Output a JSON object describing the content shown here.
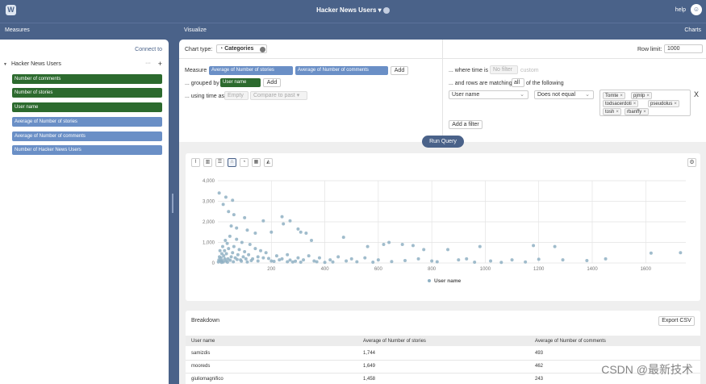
{
  "header": {
    "title": "Hacker News Users ▾",
    "help": "help"
  },
  "subbar": {
    "left": "Measures",
    "center": "Visualize",
    "right": "Charts"
  },
  "sidebar": {
    "connect": "Connect to",
    "root": "Hacker News Users",
    "dots": "···",
    "plus": "+",
    "dimensions": [
      "Number of comments",
      "Number of stories",
      "User name"
    ],
    "measures": [
      "Average of Number of stories",
      "Average of Number of comments",
      "Number of Hacker News Users"
    ]
  },
  "query": {
    "chart_type_label": "Chart type:",
    "chart_type_value": "Categories",
    "row_limit_label": "Row limit:",
    "row_limit_value": "1000",
    "measure_label": "Measure",
    "measures": [
      "Average of Number of stories",
      "Average of Number of comments"
    ],
    "add": "Add",
    "grouped_label": "... grouped by",
    "grouped_value": "User name",
    "time_label": "... using time as",
    "time_value": "Empty",
    "compare_value": "Compare to past ▾",
    "where_label": "... where time is",
    "where_value": "No filter",
    "where_custom": "custom",
    "matching_prefix": "... and rows are matching",
    "matching_value": "all",
    "matching_suffix": "of the following",
    "filter_field": "User name",
    "filter_op": "Does not equal",
    "filter_values": [
      "Tomte",
      "pjmlp",
      "todsacerdoti",
      "pseudolus",
      "tosh",
      "rbanffy"
    ],
    "clear": "X",
    "add_filter": "Add a filter",
    "run": "Run Query"
  },
  "chart_icons": [
    "line-chart-icon",
    "bar-chart-icon",
    "horizontal-bar-icon",
    "scatter-chart-icon",
    "pie-chart-icon",
    "table-icon",
    "area-chart-icon"
  ],
  "chart_data": {
    "type": "scatter",
    "title": "",
    "xlabel": "",
    "ylabel": "",
    "xlim": [
      0,
      1750
    ],
    "ylim": [
      0,
      4000
    ],
    "x_ticks": [
      "200",
      "400",
      "600",
      "800",
      "1000",
      "1200",
      "1400",
      "1600"
    ],
    "y_ticks": [
      "0",
      "1,000",
      "2,000",
      "3,000",
      "4,000"
    ],
    "legend": "User name",
    "grid": true,
    "legend_position": "bottom",
    "color": "#8fb0c3",
    "series": [
      {
        "name": "User name",
        "points": [
          [
            5,
            3400
          ],
          [
            30,
            3200
          ],
          [
            55,
            3050
          ],
          [
            20,
            2850
          ],
          [
            40,
            2500
          ],
          [
            60,
            2350
          ],
          [
            100,
            2200
          ],
          [
            170,
            2050
          ],
          [
            240,
            2250
          ],
          [
            270,
            2050
          ],
          [
            245,
            1900
          ],
          [
            50,
            1800
          ],
          [
            70,
            1700
          ],
          [
            110,
            1600
          ],
          [
            140,
            1450
          ],
          [
            200,
            1500
          ],
          [
            300,
            1650
          ],
          [
            310,
            1500
          ],
          [
            330,
            1450
          ],
          [
            350,
            1100
          ],
          [
            470,
            1250
          ],
          [
            640,
            1000
          ],
          [
            620,
            900
          ],
          [
            690,
            900
          ],
          [
            560,
            800
          ],
          [
            730,
            850
          ],
          [
            770,
            650
          ],
          [
            860,
            650
          ],
          [
            980,
            800
          ],
          [
            1180,
            850
          ],
          [
            1260,
            800
          ],
          [
            1730,
            500
          ],
          [
            1620,
            480
          ],
          [
            1450,
            200
          ],
          [
            1380,
            120
          ],
          [
            1290,
            150
          ],
          [
            1200,
            180
          ],
          [
            1100,
            150
          ],
          [
            1020,
            100
          ],
          [
            930,
            200
          ],
          [
            900,
            150
          ],
          [
            800,
            100
          ],
          [
            750,
            200
          ],
          [
            700,
            120
          ],
          [
            600,
            150
          ],
          [
            550,
            250
          ],
          [
            500,
            200
          ],
          [
            480,
            100
          ],
          [
            450,
            300
          ],
          [
            420,
            150
          ],
          [
            380,
            250
          ],
          [
            360,
            100
          ],
          [
            340,
            350
          ],
          [
            320,
            150
          ],
          [
            300,
            250
          ],
          [
            280,
            50
          ],
          [
            260,
            400
          ],
          [
            240,
            200
          ],
          [
            220,
            350
          ],
          [
            200,
            100
          ],
          [
            180,
            500
          ],
          [
            170,
            250
          ],
          [
            160,
            600
          ],
          [
            150,
            300
          ],
          [
            140,
            700
          ],
          [
            130,
            200
          ],
          [
            120,
            900
          ],
          [
            115,
            400
          ],
          [
            110,
            50
          ],
          [
            100,
            550
          ],
          [
            95,
            300
          ],
          [
            90,
            1000
          ],
          [
            85,
            150
          ],
          [
            80,
            650
          ],
          [
            75,
            400
          ],
          [
            70,
            1150
          ],
          [
            65,
            250
          ],
          [
            60,
            800
          ],
          [
            55,
            500
          ],
          [
            50,
            300
          ],
          [
            45,
            1300
          ],
          [
            40,
            700
          ],
          [
            38,
            200
          ],
          [
            35,
            950
          ],
          [
            32,
            450
          ],
          [
            30,
            100
          ],
          [
            28,
            1100
          ],
          [
            25,
            600
          ],
          [
            22,
            350
          ],
          [
            20,
            50
          ],
          [
            18,
            800
          ],
          [
            15,
            450
          ],
          [
            12,
            250
          ],
          [
            10,
            100
          ],
          [
            8,
            600
          ],
          [
            6,
            300
          ],
          [
            4,
            150
          ],
          [
            2,
            50
          ],
          [
            150,
            100
          ],
          [
            210,
            80
          ],
          [
            260,
            60
          ],
          [
            230,
            150
          ],
          [
            190,
            220
          ],
          [
            125,
            120
          ],
          [
            105,
            200
          ],
          [
            88,
            90
          ],
          [
            72,
            170
          ],
          [
            58,
            60
          ],
          [
            46,
            130
          ],
          [
            36,
            40
          ],
          [
            26,
            200
          ],
          [
            16,
            120
          ],
          [
            14,
            30
          ],
          [
            270,
            140
          ],
          [
            290,
            90
          ],
          [
            310,
            40
          ],
          [
            370,
            60
          ],
          [
            400,
            30
          ],
          [
            430,
            50
          ],
          [
            520,
            60
          ],
          [
            580,
            40
          ],
          [
            650,
            70
          ],
          [
            820,
            60
          ],
          [
            960,
            40
          ],
          [
            1060,
            30
          ],
          [
            1150,
            50
          ]
        ]
      }
    ]
  },
  "breakdown": {
    "title": "Breakdown",
    "export": "Export CSV",
    "columns": [
      "User name",
      "Average of Number of stories",
      "Average of Number of comments"
    ],
    "rows": [
      [
        "samizdis",
        "1,744",
        "493"
      ],
      [
        "mooreds",
        "1,649",
        "462"
      ],
      [
        "giuliomagnifico",
        "1,458",
        "243"
      ]
    ]
  },
  "watermark": "CSDN @最新技术"
}
